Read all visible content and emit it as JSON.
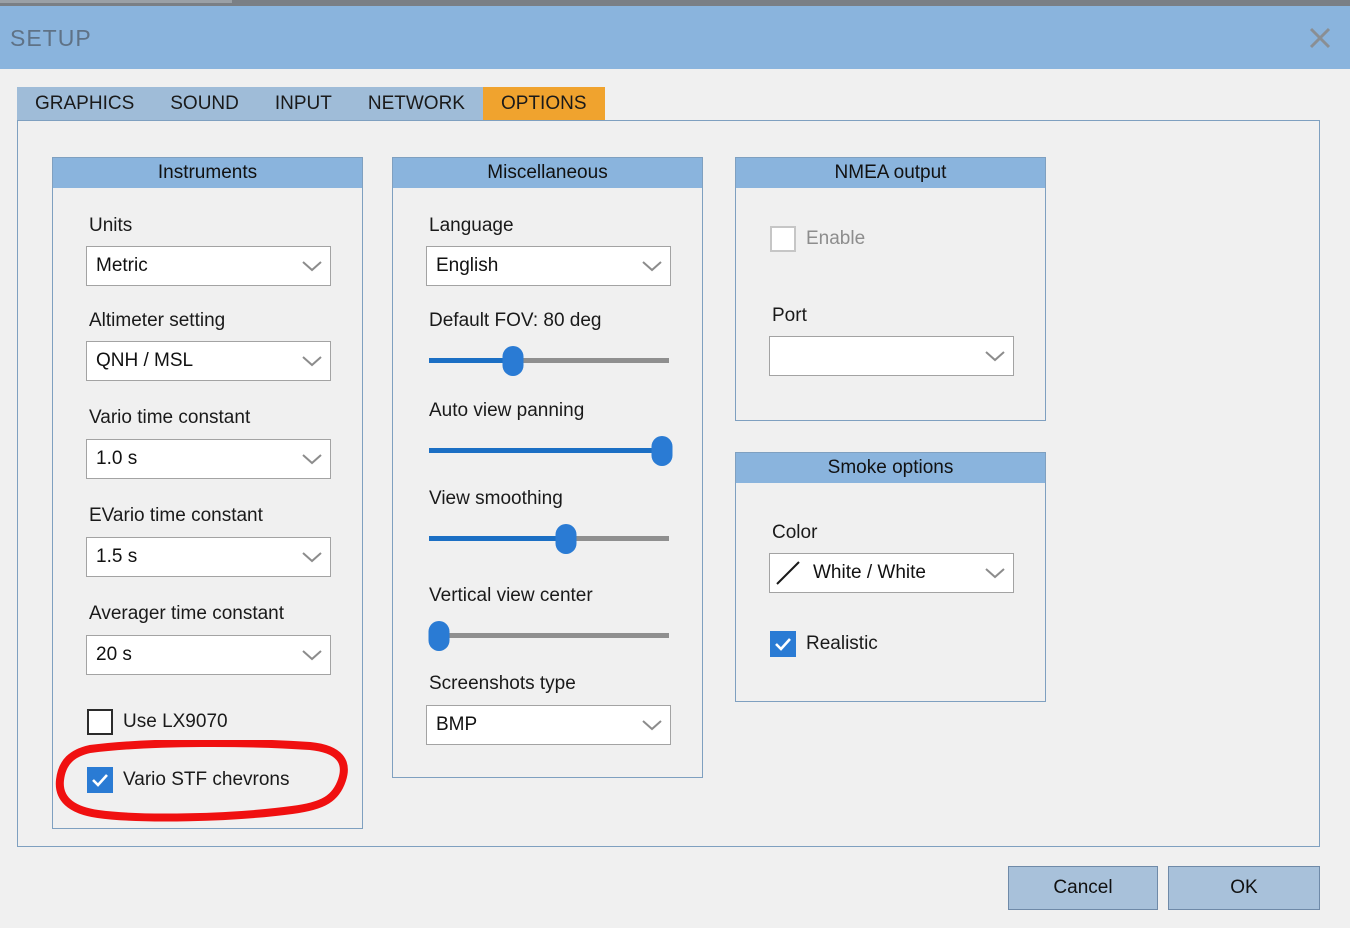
{
  "window": {
    "title": "SETUP",
    "close_icon": "close-icon"
  },
  "tabs": [
    {
      "label": "GRAPHICS",
      "active": false
    },
    {
      "label": "SOUND",
      "active": false
    },
    {
      "label": "INPUT",
      "active": false
    },
    {
      "label": "NETWORK",
      "active": false
    },
    {
      "label": "OPTIONS",
      "active": true
    }
  ],
  "instruments": {
    "title": "Instruments",
    "units": {
      "label": "Units",
      "value": "Metric"
    },
    "altimeter": {
      "label": "Altimeter setting",
      "value": "QNH / MSL"
    },
    "vario_tc": {
      "label": "Vario time constant",
      "value": "1.0 s"
    },
    "evario_tc": {
      "label": "EVario time constant",
      "value": "1.5 s"
    },
    "averager_tc": {
      "label": "Averager time constant",
      "value": "20 s"
    },
    "use_lx9070": {
      "label": "Use LX9070",
      "checked": false
    },
    "vario_stf": {
      "label": "Vario STF chevrons",
      "checked": true
    }
  },
  "miscellaneous": {
    "title": "Miscellaneous",
    "language": {
      "label": "Language",
      "value": "English"
    },
    "default_fov": {
      "label": "Default FOV: 80 deg",
      "value": 35
    },
    "auto_view_panning": {
      "label": "Auto view panning",
      "value": 97
    },
    "view_smoothing": {
      "label": "View smoothing",
      "value": 57
    },
    "vertical_view_center": {
      "label": "Vertical view center",
      "value": 2
    },
    "screenshots_type": {
      "label": "Screenshots type",
      "value": "BMP"
    }
  },
  "nmea": {
    "title": "NMEA output",
    "enable": {
      "label": "Enable",
      "checked": false,
      "disabled": true
    },
    "port": {
      "label": "Port",
      "value": ""
    }
  },
  "smoke": {
    "title": "Smoke options",
    "color": {
      "label": "Color",
      "value": "White / White",
      "swatch": "diagonal-line-swatch"
    },
    "realistic": {
      "label": "Realistic",
      "checked": true
    }
  },
  "footer": {
    "cancel": "Cancel",
    "ok": "OK"
  },
  "annotation": {
    "shape": "red-ellipse-highlight",
    "color": "#f01010",
    "targets": "Vario STF chevrons"
  },
  "colors": {
    "titlebar": "#8ab4dd",
    "tab_inactive": "#9fbcd8",
    "tab_active": "#f0a32e",
    "group_header": "#8ab4dd",
    "accent_blue": "#2a7bd4",
    "button_face": "#a8c1da",
    "annotation_red": "#f01010"
  }
}
